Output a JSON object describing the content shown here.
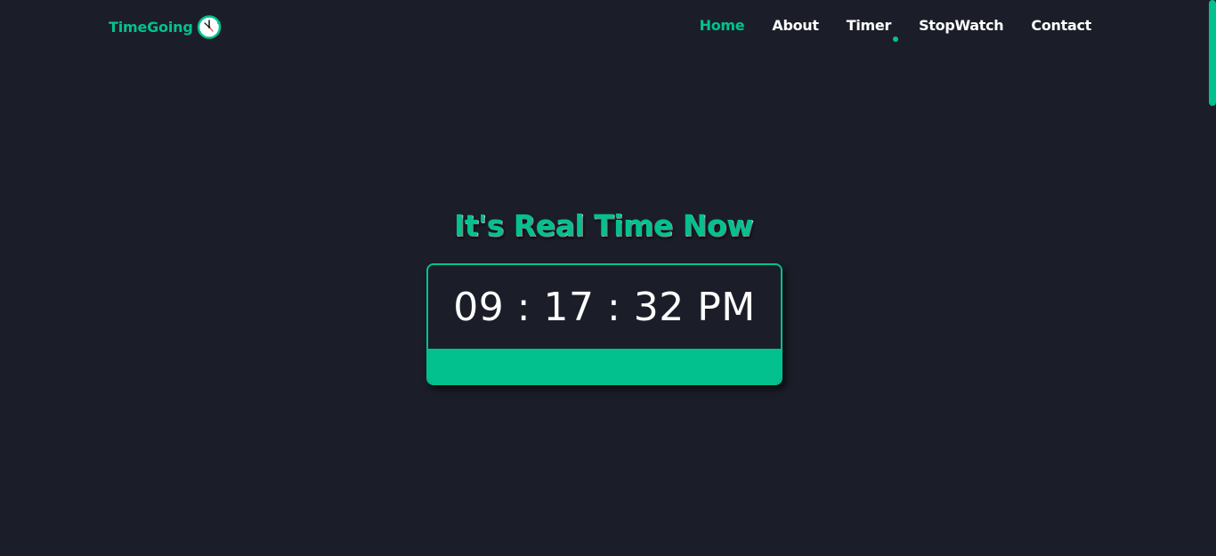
{
  "brand": {
    "name": "TimeGoing",
    "icon": "clock-icon"
  },
  "nav": {
    "items": [
      {
        "label": "Home",
        "active": true
      },
      {
        "label": "About",
        "active": false
      },
      {
        "label": "Timer",
        "active": false
      },
      {
        "label": "StopWatch",
        "active": false
      },
      {
        "label": "Contact",
        "active": false
      }
    ]
  },
  "hero": {
    "title": "It's Real Time Now"
  },
  "clock": {
    "hours": "09",
    "minutes": "17",
    "seconds": "32",
    "period": "PM",
    "display": "09 : 17 : 32 PM"
  },
  "colors": {
    "accent": "#03c18f",
    "background": "#1b1e28",
    "text": "#ffffff"
  }
}
